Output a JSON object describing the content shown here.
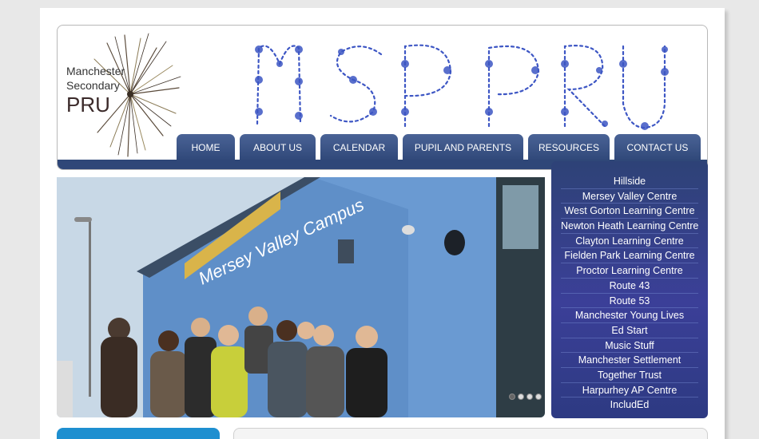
{
  "logo": {
    "line1": "Manchester",
    "line2": "Secondary",
    "line3": "PRU"
  },
  "banner": {
    "text": "MSPRU"
  },
  "nav": {
    "items": [
      {
        "label": "HOME"
      },
      {
        "label": "ABOUT US"
      },
      {
        "label": "CALENDAR"
      },
      {
        "label": "PUPIL AND PARENTS"
      },
      {
        "label": "RESOURCES"
      },
      {
        "label": "CONTACT US"
      }
    ]
  },
  "hero": {
    "sign_text": "Mersey Valley Campus"
  },
  "sidebar": {
    "items": [
      {
        "label": "Hillside"
      },
      {
        "label": "Mersey Valley Centre"
      },
      {
        "label": "West Gorton Learning Centre"
      },
      {
        "label": "Newton Heath Learning Centre"
      },
      {
        "label": "Clayton Learning Centre"
      },
      {
        "label": "Fielden Park Learning Centre"
      },
      {
        "label": "Proctor Learning Centre"
      },
      {
        "label": "Route 43"
      },
      {
        "label": "Route 53"
      },
      {
        "label": "Manchester Young Lives"
      },
      {
        "label": "Ed Start"
      },
      {
        "label": "Music Stuff"
      },
      {
        "label": "Manchester Settlement"
      },
      {
        "label": "Together Trust"
      },
      {
        "label": "Harpurhey AP Centre"
      },
      {
        "label": "IncludEd"
      }
    ]
  },
  "colors": {
    "nav_bar": "#2f4778",
    "sidebar": "#3b3f98",
    "accent_blue": "#1e8fd0",
    "banner_ink": "#3d56c4"
  }
}
